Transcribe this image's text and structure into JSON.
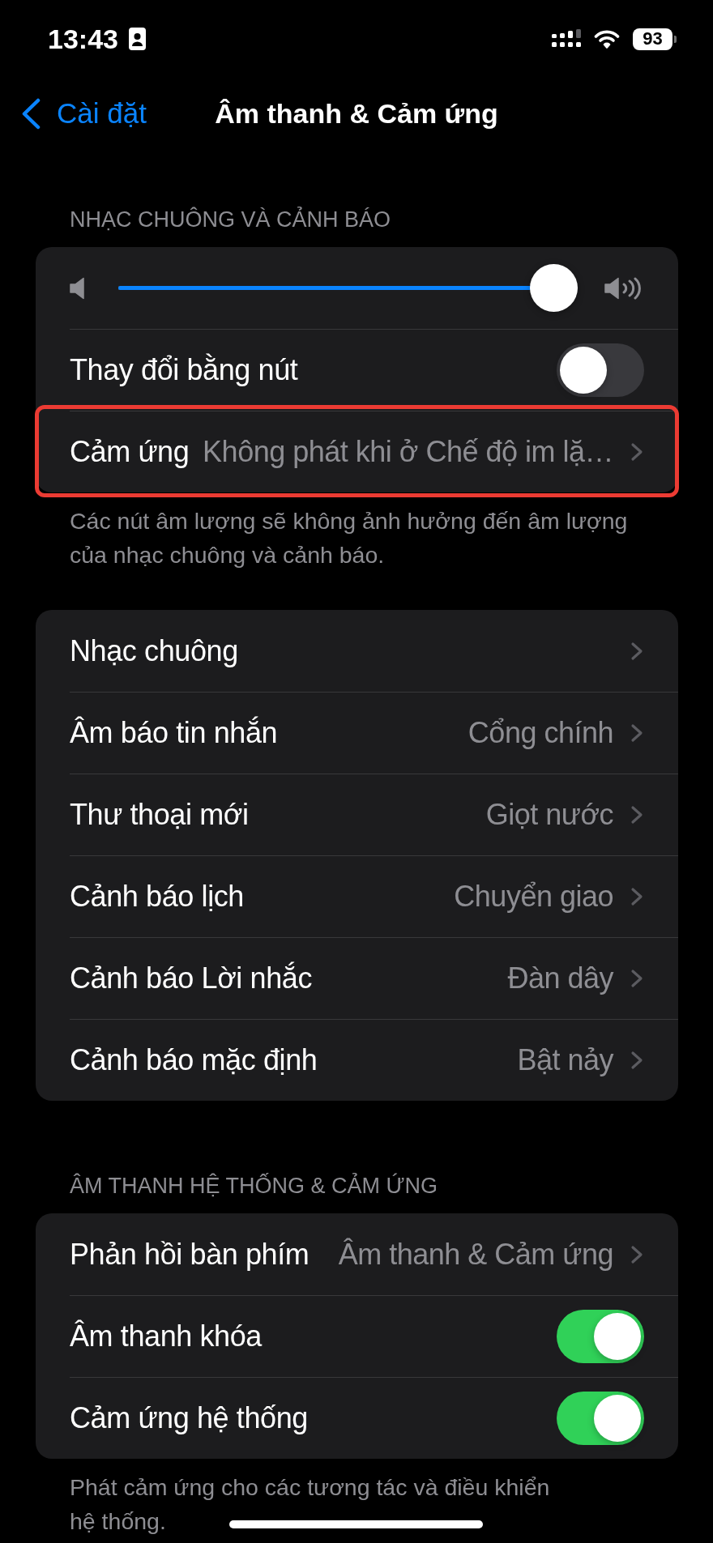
{
  "status_bar": {
    "time": "13:43",
    "battery": "93"
  },
  "nav": {
    "back": "Cài đặt",
    "title": "Âm thanh & Cảm ứng"
  },
  "groups": [
    {
      "header": "NHẠC CHUÔNG VÀ CẢNH BÁO",
      "rows": [
        {
          "kind": "slider",
          "level": 1,
          "highlighted": false
        },
        {
          "kind": "toggle",
          "label": "Thay đổi bằng nút",
          "on": false,
          "highlighted": false
        },
        {
          "kind": "link",
          "label": "Cảm ứng",
          "value": "Không phát khi ở Chế độ im lặ…",
          "highlighted": true
        }
      ],
      "footer_lines": [
        "Các nút âm lượng sẽ không ảnh hưởng đến âm lượng",
        "của nhạc chuông và cảnh báo."
      ]
    },
    {
      "rows": [
        {
          "kind": "link",
          "label": "Nhạc chuông",
          "highlighted": false
        },
        {
          "kind": "link",
          "label": "Âm báo tin nhắn",
          "value": "Cổng chính",
          "highlighted": false
        },
        {
          "kind": "link",
          "label": "Thư thoại mới",
          "value": "Giọt nước",
          "highlighted": false
        },
        {
          "kind": "link",
          "label": "Cảnh báo lịch",
          "value": "Chuyển giao",
          "highlighted": false
        },
        {
          "kind": "link",
          "label": "Cảnh báo Lời nhắc",
          "value": "Đàn dây",
          "highlighted": false
        },
        {
          "kind": "link",
          "label": "Cảnh báo mặc định",
          "value": "Bật nảy",
          "highlighted": false
        }
      ]
    },
    {
      "header": "ÂM THANH HỆ THỐNG & CẢM ỨNG",
      "rows": [
        {
          "kind": "link",
          "label": "Phản hồi bàn phím",
          "value": "Âm thanh & Cảm ứng",
          "highlighted": false
        },
        {
          "kind": "toggle",
          "label": "Âm thanh khóa",
          "on": true,
          "highlighted": false
        },
        {
          "kind": "toggle",
          "label": "Cảm ứng hệ thống",
          "on": true,
          "highlighted": false
        }
      ],
      "footer_lines": [
        "Phát cảm ứng cho các tương tác và điều khiển",
        "hệ thống."
      ]
    }
  ]
}
